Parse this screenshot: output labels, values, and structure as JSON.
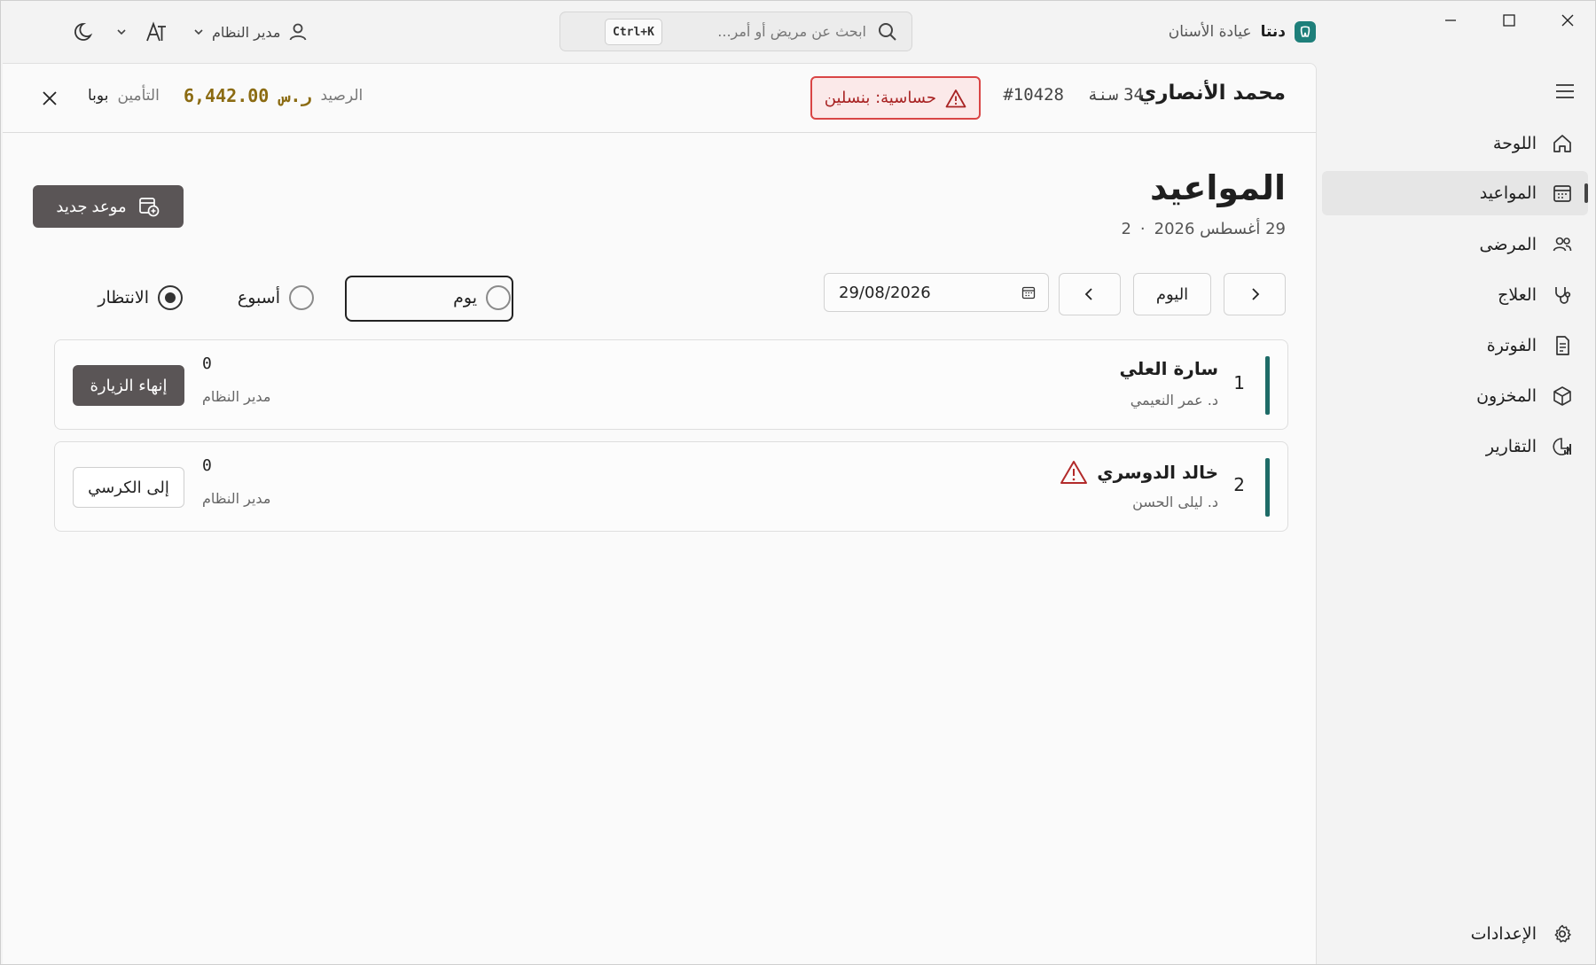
{
  "app": {
    "name": "دنتا",
    "clinic": "عيادة الأسنان"
  },
  "search": {
    "placeholder": "ابحث عن مريض أو أمر...",
    "shortcut": "Ctrl+K"
  },
  "user": {
    "name": "مدير النظام"
  },
  "icons": {
    "theme": "moon-icon",
    "font_size": "text-size-icon"
  },
  "sidebar": {
    "items": [
      {
        "label": "اللوحة",
        "icon": "home-icon"
      },
      {
        "label": "المواعيد",
        "icon": "calendar-icon",
        "active": true
      },
      {
        "label": "المرضى",
        "icon": "users-icon"
      },
      {
        "label": "العلاج",
        "icon": "stethoscope-icon"
      },
      {
        "label": "الفوترة",
        "icon": "invoice-icon"
      },
      {
        "label": "المخزون",
        "icon": "box-icon"
      },
      {
        "label": "التقارير",
        "icon": "reports-icon"
      }
    ],
    "settings_label": "الإعدادات"
  },
  "patient": {
    "name": "محمد الأنصاري",
    "age_value": "34",
    "age_unit": "سنة",
    "id": "#10428",
    "allergy": "حساسية: بنسلين",
    "balance_label": "الرصيد",
    "balance_value": "6,442.00 ر.س",
    "insurance_label": "التأمين",
    "insurance_value": "بوبا"
  },
  "page": {
    "title": "المواعيد",
    "date": "29 أغسطس 2026",
    "separator": "·",
    "count": "2",
    "new_appointment": "موعد جديد"
  },
  "toolbar": {
    "today": "اليوم",
    "date_value": "29/08/2026"
  },
  "view_modes": [
    {
      "label": "يوم",
      "checked": false
    },
    {
      "label": "أسبوع",
      "checked": false
    },
    {
      "label": "الانتظار",
      "checked": true
    }
  ],
  "appointments": [
    {
      "number": "1",
      "patient": "سارة العلي",
      "doctor": "د. عمر النعيمي",
      "count": "0",
      "created_by": "مدير النظام",
      "action": "إنهاء الزيارة",
      "warning": false
    },
    {
      "number": "2",
      "patient": "خالد الدوسري",
      "doctor": "د. ليلى الحسن",
      "count": "0",
      "created_by": "مدير النظام",
      "action": "إلى الكرسي",
      "warning": true
    }
  ],
  "colors": {
    "accent": "#1e6b67",
    "brand": "#1e7f7a",
    "danger": "#d94545",
    "balance": "#8b6b12",
    "primary_button": "#5a5556"
  }
}
